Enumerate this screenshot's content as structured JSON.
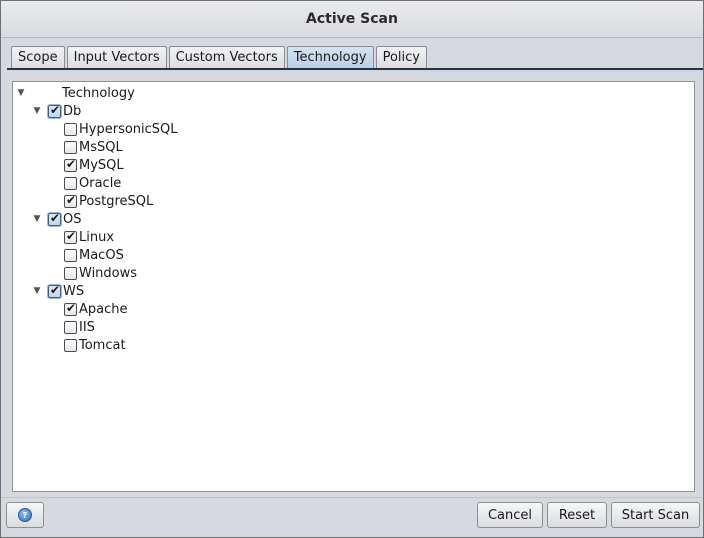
{
  "window": {
    "title": "Active Scan"
  },
  "tabs": [
    {
      "label": "Scope"
    },
    {
      "label": "Input Vectors"
    },
    {
      "label": "Custom Vectors"
    },
    {
      "label": "Technology",
      "active": true
    },
    {
      "label": "Policy"
    }
  ],
  "tree": {
    "root": "Technology",
    "groups": [
      {
        "label": "Db",
        "checked": true,
        "items": [
          {
            "label": "HypersonicSQL",
            "checked": false
          },
          {
            "label": "MsSQL",
            "checked": false
          },
          {
            "label": "MySQL",
            "checked": true
          },
          {
            "label": "Oracle",
            "checked": false
          },
          {
            "label": "PostgreSQL",
            "checked": true
          }
        ]
      },
      {
        "label": "OS",
        "checked": true,
        "items": [
          {
            "label": "Linux",
            "checked": true
          },
          {
            "label": "MacOS",
            "checked": false
          },
          {
            "label": "Windows",
            "checked": false
          }
        ]
      },
      {
        "label": "WS",
        "checked": true,
        "items": [
          {
            "label": "Apache",
            "checked": true
          },
          {
            "label": "IIS",
            "checked": false
          },
          {
            "label": "Tomcat",
            "checked": false
          }
        ]
      }
    ]
  },
  "buttons": {
    "help_icon": "help-icon",
    "cancel": "Cancel",
    "reset": "Reset",
    "start": "Start Scan"
  },
  "colors": {
    "active_tab": "#c4d7ec",
    "accent": "#2e6db3"
  }
}
